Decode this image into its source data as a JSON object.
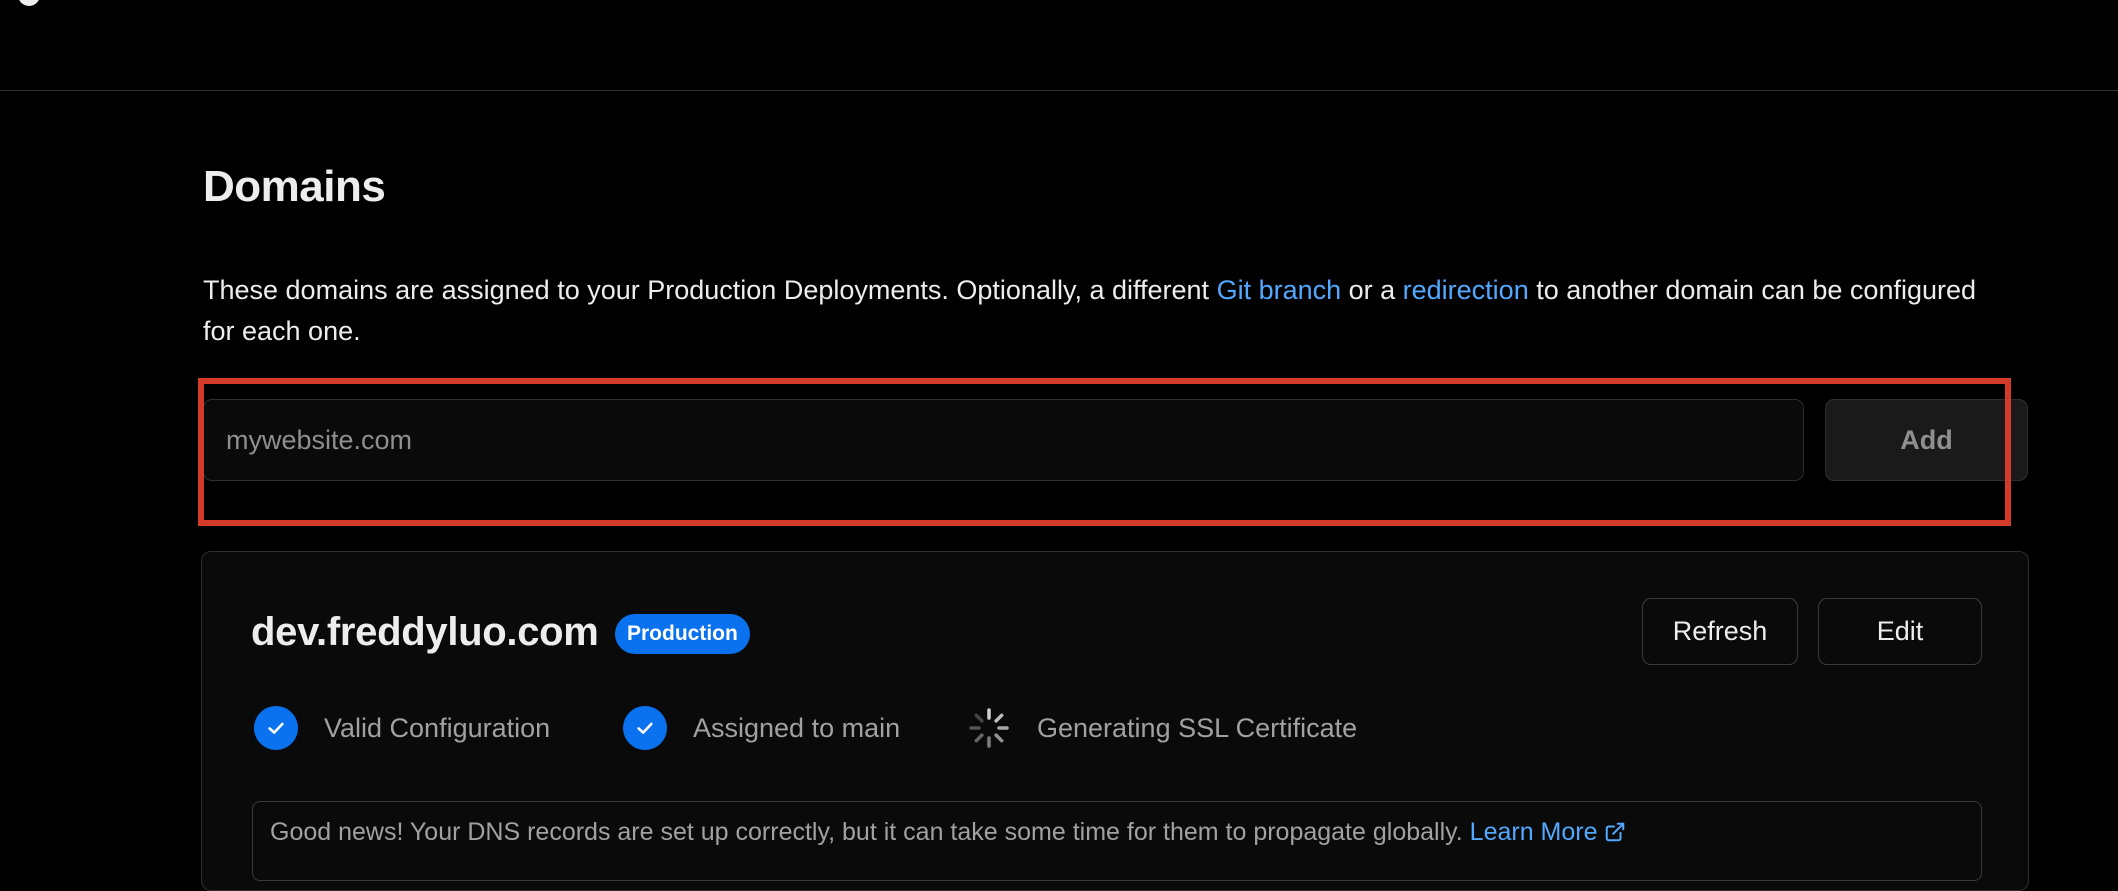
{
  "page": {
    "title": "Domains",
    "description": {
      "part1": "These domains are assigned to your Production Deployments. Optionally, a different ",
      "link1": "Git branch",
      "part2": " or a ",
      "link2": "redirection",
      "part3": " to another domain can be configured for each one."
    }
  },
  "add_domain": {
    "placeholder": "mywebsite.com",
    "value": "",
    "add_label": "Add"
  },
  "domain_card": {
    "name": "dev.freddyluo.com",
    "badge": "Production",
    "refresh_label": "Refresh",
    "edit_label": "Edit",
    "statuses": [
      {
        "label": "Valid Configuration",
        "icon": "check-circle-icon"
      },
      {
        "label": "Assigned to main",
        "icon": "check-circle-icon"
      },
      {
        "label": "Generating SSL Certificate",
        "icon": "spinner-icon"
      }
    ],
    "notice": {
      "text": "Good news! Your DNS records are set up correctly, but it can take some time for them to propagate globally. ",
      "link": "Learn More"
    }
  },
  "colors": {
    "accent_blue": "#0a72ef",
    "link_blue": "#52a8ff",
    "highlight_red": "#d23a2a"
  }
}
